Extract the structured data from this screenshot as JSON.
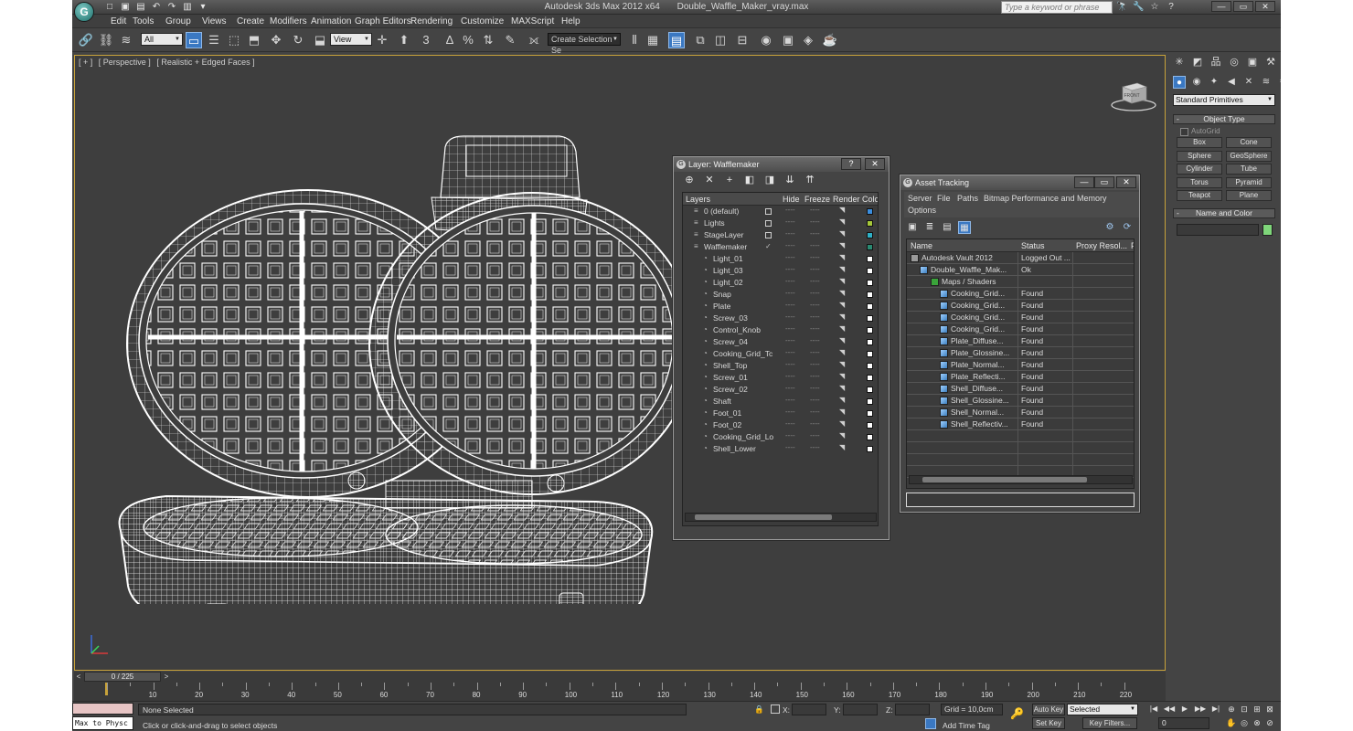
{
  "app": {
    "title": "Autodesk 3ds Max  2012 x64",
    "file": "Double_Waffle_Maker_vray.max",
    "logo_glyph": "G",
    "search_placeholder": "Type a keyword or phrase",
    "win_min": "—",
    "win_max": "▭",
    "win_close": "✕"
  },
  "quick_access": [
    "□",
    "▣",
    "▤",
    "↶",
    "↷",
    "▥",
    "▾"
  ],
  "title_tools": [
    "🔭",
    "🔧",
    "☆",
    "?"
  ],
  "menu": [
    "Edit",
    "Tools",
    "Group",
    "Views",
    "Create",
    "Modifiers",
    "Animation",
    "Graph Editors",
    "Rendering",
    "Customize",
    "MAXScript",
    "Help"
  ],
  "toolbar": {
    "selection_filter": "All",
    "ref_coord": "View",
    "named_selection": "Create Selection Se",
    "icons": [
      "🔗",
      "⛓",
      "≋",
      "▭",
      "☰",
      "⬚",
      "⬒",
      "✥",
      "↻",
      "⬓",
      "✛",
      "⬆",
      "3",
      "∆",
      "%",
      "⇅",
      "✎",
      "⟗",
      "⫴",
      "▦",
      "▤",
      "⧉",
      "◫",
      "⊟",
      "◉",
      "▣",
      "◈",
      "☕"
    ]
  },
  "viewport": {
    "labels": [
      "[ + ]",
      "[ Perspective ]",
      "[ Realistic + Edged Faces ]"
    ],
    "viewcube_label": "FRONT"
  },
  "layer_panel": {
    "title": "Layer: Wafflemaker",
    "help": "?",
    "close": "✕",
    "toolbar": [
      "⊕",
      "✕",
      "+",
      "◧",
      "◨",
      "⇊",
      "⇈"
    ],
    "headers": [
      "Layers",
      "Hide",
      "Freeze",
      "Render",
      "Color"
    ],
    "dots": "----",
    "render_glyph": "◥",
    "check": "✓",
    "rows": [
      {
        "name": "0 (default)",
        "level": 0,
        "color": "#3b8ede"
      },
      {
        "name": "Lights",
        "level": 0,
        "color": "#a6c83a"
      },
      {
        "name": "StageLayer",
        "level": 0,
        "color": "#2fb1c7"
      },
      {
        "name": "Wafflemaker",
        "level": 0,
        "color": "#2a8a72",
        "active": true
      },
      {
        "name": "Light_01",
        "level": 1
      },
      {
        "name": "Light_03",
        "level": 1
      },
      {
        "name": "Light_02",
        "level": 1
      },
      {
        "name": "Snap",
        "level": 1
      },
      {
        "name": "Plate",
        "level": 1
      },
      {
        "name": "Screw_03",
        "level": 1
      },
      {
        "name": "Control_Knob",
        "level": 1
      },
      {
        "name": "Screw_04",
        "level": 1
      },
      {
        "name": "Cooking_Grid_Tc",
        "level": 1
      },
      {
        "name": "Shell_Top",
        "level": 1
      },
      {
        "name": "Screw_01",
        "level": 1
      },
      {
        "name": "Screw_02",
        "level": 1
      },
      {
        "name": "Shaft",
        "level": 1
      },
      {
        "name": "Foot_01",
        "level": 1
      },
      {
        "name": "Foot_02",
        "level": 1
      },
      {
        "name": "Cooking_Grid_Lo",
        "level": 1
      },
      {
        "name": "Shell_Lower",
        "level": 1
      }
    ]
  },
  "asset_panel": {
    "title": "Asset Tracking",
    "min": "—",
    "max": "▭",
    "close": "✕",
    "menu": [
      "Server",
      "File",
      "Paths",
      "Bitmap Performance and Memory",
      "Options"
    ],
    "toolbar": [
      "▣",
      "≣",
      "▤",
      "▦"
    ],
    "toolbar_right": [
      "⚙",
      "⟳"
    ],
    "headers": [
      "Name",
      "Status",
      "Proxy Resol...",
      "P"
    ],
    "rows": [
      {
        "name": "Autodesk Vault 2012",
        "status": "Logged Out ...",
        "level": 0,
        "icon": "vault"
      },
      {
        "name": "Double_Waffle_Mak...",
        "status": "Ok",
        "level": 1,
        "icon": "file"
      },
      {
        "name": "Maps / Shaders",
        "status": "",
        "level": 2,
        "icon": "maps"
      },
      {
        "name": "Cooking_Grid...",
        "status": "Found",
        "level": 3,
        "icon": "img"
      },
      {
        "name": "Cooking_Grid...",
        "status": "Found",
        "level": 3,
        "icon": "img"
      },
      {
        "name": "Cooking_Grid...",
        "status": "Found",
        "level": 3,
        "icon": "img"
      },
      {
        "name": "Cooking_Grid...",
        "status": "Found",
        "level": 3,
        "icon": "img"
      },
      {
        "name": "Plate_Diffuse...",
        "status": "Found",
        "level": 3,
        "icon": "img"
      },
      {
        "name": "Plate_Glossine...",
        "status": "Found",
        "level": 3,
        "icon": "img"
      },
      {
        "name": "Plate_Normal...",
        "status": "Found",
        "level": 3,
        "icon": "img"
      },
      {
        "name": "Plate_Reflecti...",
        "status": "Found",
        "level": 3,
        "icon": "img"
      },
      {
        "name": "Shell_Diffuse...",
        "status": "Found",
        "level": 3,
        "icon": "img"
      },
      {
        "name": "Shell_Glossine...",
        "status": "Found",
        "level": 3,
        "icon": "img"
      },
      {
        "name": "Shell_Normal...",
        "status": "Found",
        "level": 3,
        "icon": "img"
      },
      {
        "name": "Shell_Reflectiv...",
        "status": "Found",
        "level": 3,
        "icon": "img"
      }
    ]
  },
  "command_panel": {
    "tabs": [
      "✳",
      "◩",
      "品",
      "◎",
      "▣",
      "⚒"
    ],
    "create_icons": [
      "●",
      "◉",
      "✦",
      "◀",
      "✕",
      "≋",
      "⚙"
    ],
    "category": "Standard Primitives",
    "object_type_title": "Object Type",
    "autogrid": "AutoGrid",
    "primitives": [
      "Box",
      "Cone",
      "Sphere",
      "GeoSphere",
      "Cylinder",
      "Tube",
      "Torus",
      "Pyramid",
      "Teapot",
      "Plane"
    ],
    "name_color_title": "Name and Color"
  },
  "timeline": {
    "frame": "0 / 225",
    "prev": "<",
    "next": ">",
    "ticks": [
      "10",
      "20",
      "30",
      "40",
      "50",
      "60",
      "70",
      "80",
      "90",
      "100",
      "110",
      "120",
      "130",
      "140",
      "150",
      "160",
      "170",
      "180",
      "190",
      "200",
      "210",
      "220"
    ]
  },
  "status": {
    "maxscript": "Max to Physc",
    "selection": "None Selected",
    "prompt": "Click or click-and-drag to select objects",
    "x_label": "X:",
    "y_label": "Y:",
    "z_label": "Z:",
    "grid": "Grid = 10,0cm",
    "add_time_tag": "Add Time Tag",
    "auto_key": "Auto Key",
    "set_key": "Set Key",
    "selected": "Selected",
    "key_filters": "Key Filters...",
    "current_frame": "0",
    "lock_icon": "🔒",
    "key_icon": "🔑",
    "playback": [
      "|◀",
      "◀◀",
      "▶",
      "▶▶",
      "▶|"
    ],
    "nav": [
      "⊕",
      "⊡",
      "⊞",
      "⊠",
      "✋",
      "◎",
      "⊗",
      "⊘"
    ]
  }
}
